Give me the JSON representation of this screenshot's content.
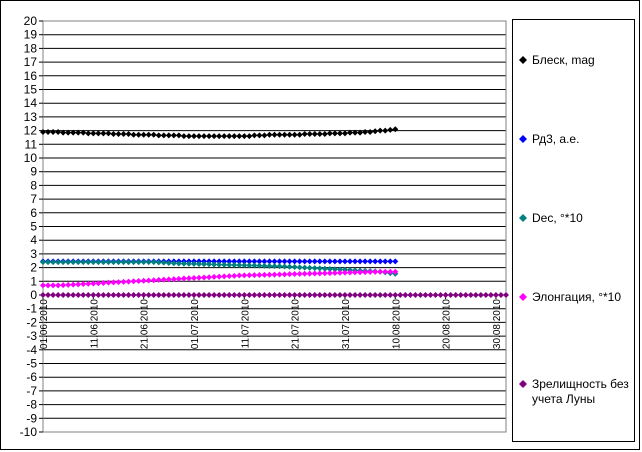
{
  "chart_data": {
    "type": "scatter",
    "title": "",
    "xlabel": "",
    "ylabel": "",
    "ylim": [
      -10,
      20
    ],
    "y_ticks": [
      20,
      19,
      18,
      17,
      16,
      15,
      14,
      13,
      12,
      11,
      10,
      9,
      8,
      7,
      6,
      5,
      4,
      3,
      2,
      1,
      0,
      -1,
      -2,
      -3,
      -4,
      -5,
      -6,
      -7,
      -8,
      -9,
      -10
    ],
    "x_tick_labels": [
      "01.06.2010",
      "11.06.2010",
      "21.06.2010",
      "01.07.2010",
      "11.07.2010",
      "21.07.2010",
      "31.07.2010",
      "10.08.2010",
      "20.08.2010",
      "30.08.2010"
    ],
    "x_start": "01.06.2010",
    "x_end": "01.09.2010",
    "grid": "horizontal",
    "legend_position": "right",
    "series": [
      {
        "name": "Блеск, mag",
        "color": "#000000",
        "start": "01.06.2010",
        "values": [
          11.9,
          11.9,
          11.9,
          11.9,
          11.85,
          11.85,
          11.85,
          11.85,
          11.85,
          11.8,
          11.8,
          11.8,
          11.8,
          11.8,
          11.75,
          11.75,
          11.75,
          11.75,
          11.7,
          11.7,
          11.7,
          11.7,
          11.7,
          11.65,
          11.65,
          11.65,
          11.65,
          11.65,
          11.6,
          11.6,
          11.6,
          11.6,
          11.6,
          11.6,
          11.6,
          11.6,
          11.6,
          11.6,
          11.6,
          11.6,
          11.6,
          11.6,
          11.65,
          11.65,
          11.65,
          11.7,
          11.7,
          11.7,
          11.7,
          11.7,
          11.7,
          11.7,
          11.75,
          11.75,
          11.75,
          11.75,
          11.75,
          11.8,
          11.8,
          11.8,
          11.8,
          11.85,
          11.85,
          11.85,
          11.9,
          11.9,
          11.95,
          12.0,
          12.0,
          12.05,
          12.1
        ]
      },
      {
        "name": "Рд3, а.е.",
        "color": "#0000ff",
        "start": "01.06.2010",
        "values": [
          2.45,
          2.45,
          2.45,
          2.45,
          2.45,
          2.45,
          2.45,
          2.45,
          2.45,
          2.45,
          2.45,
          2.45,
          2.45,
          2.45,
          2.45,
          2.45,
          2.45,
          2.45,
          2.45,
          2.45,
          2.45,
          2.45,
          2.45,
          2.45,
          2.45,
          2.45,
          2.45,
          2.45,
          2.45,
          2.45,
          2.45,
          2.45,
          2.45,
          2.45,
          2.45,
          2.45,
          2.45,
          2.45,
          2.45,
          2.45,
          2.45,
          2.45,
          2.45,
          2.45,
          2.45,
          2.45,
          2.45,
          2.45,
          2.45,
          2.45,
          2.45,
          2.45,
          2.45,
          2.45,
          2.45,
          2.45,
          2.45,
          2.45,
          2.45,
          2.45,
          2.45,
          2.45,
          2.45,
          2.45,
          2.45,
          2.45,
          2.45,
          2.45,
          2.45,
          2.45,
          2.45
        ]
      },
      {
        "name": "Dec, °*10",
        "color": "#008080",
        "start": "01.06.2010",
        "values": [
          2.4,
          2.4,
          2.4,
          2.4,
          2.4,
          2.4,
          2.4,
          2.4,
          2.4,
          2.4,
          2.4,
          2.4,
          2.4,
          2.4,
          2.4,
          2.4,
          2.4,
          2.4,
          2.4,
          2.4,
          2.4,
          2.4,
          2.4,
          2.38,
          2.36,
          2.34,
          2.32,
          2.3,
          2.29,
          2.28,
          2.27,
          2.26,
          2.25,
          2.24,
          2.23,
          2.22,
          2.21,
          2.2,
          2.19,
          2.18,
          2.17,
          2.16,
          2.15,
          2.14,
          2.13,
          2.12,
          2.11,
          2.1,
          2.08,
          2.06,
          2.04,
          2.02,
          2.0,
          1.98,
          1.96,
          1.94,
          1.92,
          1.9,
          1.88,
          1.86,
          1.84,
          1.82,
          1.8,
          1.78,
          1.76,
          1.74,
          1.72,
          1.7,
          1.65,
          1.6,
          1.55
        ]
      },
      {
        "name": "Элонгация, °*10",
        "color": "#ff00ff",
        "start": "01.06.2010",
        "values": [
          0.7,
          0.7,
          0.7,
          0.7,
          0.72,
          0.74,
          0.76,
          0.78,
          0.8,
          0.82,
          0.84,
          0.86,
          0.88,
          0.9,
          0.92,
          0.94,
          0.96,
          0.98,
          1.0,
          1.02,
          1.04,
          1.06,
          1.08,
          1.1,
          1.12,
          1.14,
          1.16,
          1.18,
          1.2,
          1.22,
          1.24,
          1.26,
          1.28,
          1.3,
          1.32,
          1.34,
          1.36,
          1.38,
          1.4,
          1.42,
          1.43,
          1.44,
          1.45,
          1.46,
          1.47,
          1.48,
          1.49,
          1.5,
          1.51,
          1.52,
          1.53,
          1.54,
          1.55,
          1.56,
          1.57,
          1.58,
          1.59,
          1.6,
          1.61,
          1.62,
          1.63,
          1.64,
          1.65,
          1.66,
          1.67,
          1.68,
          1.69,
          1.7,
          1.7,
          1.7,
          1.7
        ]
      },
      {
        "name": "Зрелищность без учета Луны",
        "color": "#800080",
        "start": "01.06.2010",
        "values": [
          0,
          0,
          0,
          0,
          0,
          0,
          0,
          0,
          0,
          0,
          0,
          0,
          0,
          0,
          0,
          0,
          0,
          0,
          0,
          0,
          0,
          0,
          0,
          0,
          0,
          0,
          0,
          0,
          0,
          0,
          0,
          0,
          0,
          0,
          0,
          0,
          0,
          0,
          0,
          0,
          0,
          0,
          0,
          0,
          0,
          0,
          0,
          0,
          0,
          0,
          0,
          0,
          0,
          0,
          0,
          0,
          0,
          0,
          0,
          0,
          0,
          0,
          0,
          0,
          0,
          0,
          0,
          0,
          0,
          0,
          0,
          0,
          0,
          0,
          0,
          0,
          0,
          0,
          0,
          0,
          0,
          0,
          0,
          0,
          0,
          0,
          0,
          0,
          0,
          0,
          0,
          0,
          0
        ]
      }
    ]
  }
}
